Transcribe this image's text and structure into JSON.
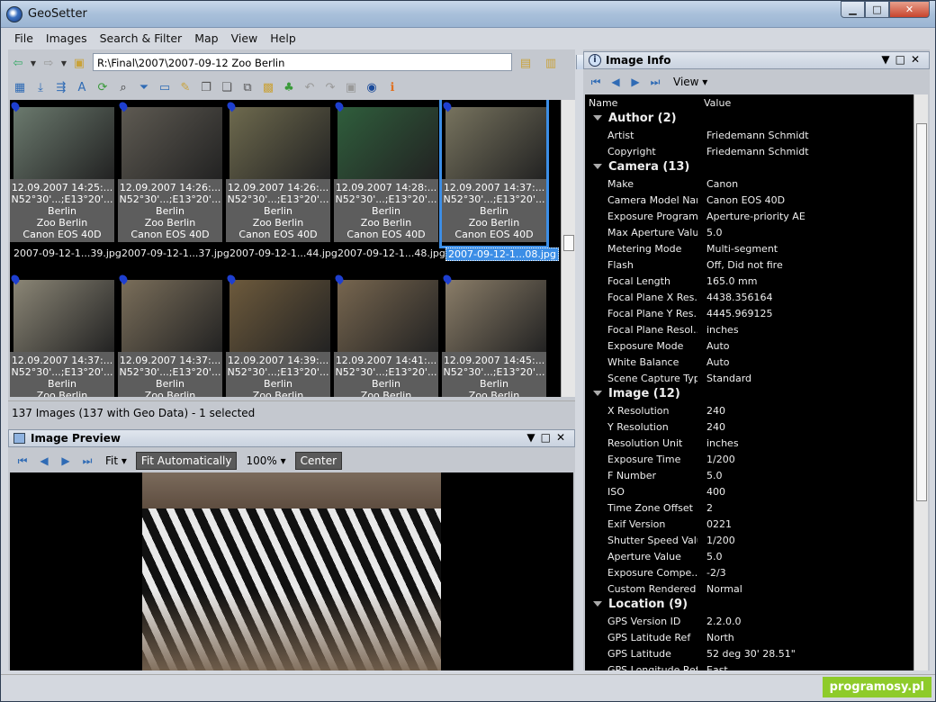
{
  "window": {
    "title": "GeoSetter"
  },
  "menu": [
    "File",
    "Images",
    "Search & Filter",
    "Map",
    "View",
    "Help"
  ],
  "address": {
    "path": "R:\\Final\\2007\\2007-09-12 Zoo Berlin"
  },
  "thumbnails": [
    {
      "meta": [
        "12.09.2007 14:25:...",
        "N52°30'...;E13°20'...",
        "Berlin",
        "Zoo Berlin",
        "Canon EOS 40D"
      ],
      "file": "2007-09-12-1...39.jpg",
      "color": "#6b7a6e"
    },
    {
      "meta": [
        "12.09.2007 14:26:...",
        "N52°30'...;E13°20'...",
        "Berlin",
        "Zoo Berlin",
        "Canon EOS 40D"
      ],
      "file": "2007-09-12-1...37.jpg",
      "color": "#5e5a52"
    },
    {
      "meta": [
        "12.09.2007 14:26:...",
        "N52°30'...;E13°20'...",
        "Berlin",
        "Zoo Berlin",
        "Canon EOS 40D"
      ],
      "file": "2007-09-12-1...44.jpg",
      "color": "#6e6a4e"
    },
    {
      "meta": [
        "12.09.2007 14:28:...",
        "N52°30'...;E13°20'...",
        "Berlin",
        "Zoo Berlin",
        "Canon EOS 40D"
      ],
      "file": "2007-09-12-1...48.jpg",
      "color": "#2f5e3c"
    },
    {
      "meta": [
        "12.09.2007 14:37:...",
        "N52°30'...;E13°20'...",
        "Berlin",
        "Zoo Berlin",
        "Canon EOS 40D"
      ],
      "file": "2007-09-12-1...08.jpg",
      "color": "#77735e"
    },
    {
      "meta": [
        "12.09.2007 14:37:...",
        "N52°30'...;E13°20'...",
        "Berlin",
        "Zoo Berlin"
      ],
      "file": "",
      "color": "#8b8676"
    },
    {
      "meta": [
        "12.09.2007 14:37:...",
        "N52°30'...;E13°20'...",
        "Berlin",
        "Zoo Berlin"
      ],
      "file": "",
      "color": "#7a6e5a"
    },
    {
      "meta": [
        "12.09.2007 14:39:...",
        "N52°30'...;E13°20'...",
        "Berlin",
        "Zoo Berlin"
      ],
      "file": "",
      "color": "#6d5a3c"
    },
    {
      "meta": [
        "12.09.2007 14:41:...",
        "N52°30'...;E13°20'...",
        "Berlin",
        "Zoo Berlin"
      ],
      "file": "",
      "color": "#77664f"
    },
    {
      "meta": [
        "12.09.2007 14:45:...",
        "N52°30'...;E13°20'...",
        "Berlin",
        "Zoo Berlin"
      ],
      "file": "",
      "color": "#8a7d68"
    }
  ],
  "status": "137 Images (137 with Geo Data) - 1 selected",
  "preview": {
    "title": "Image Preview",
    "fit": "Fit",
    "fit_auto": "Fit Automatically",
    "zoom": "100%",
    "center": "Center"
  },
  "info": {
    "title": "Image Info",
    "view": "View",
    "col_name": "Name",
    "col_value": "Value"
  },
  "props": [
    {
      "g": "Author (2)"
    },
    {
      "k": "Artist",
      "v": "Friedemann Schmidt"
    },
    {
      "k": "Copyright",
      "v": "Friedemann Schmidt"
    },
    {
      "g": "Camera (13)"
    },
    {
      "k": "Make",
      "v": "Canon"
    },
    {
      "k": "Camera Model Name",
      "v": "Canon EOS 40D"
    },
    {
      "k": "Exposure Program",
      "v": "Aperture-priority AE"
    },
    {
      "k": "Max Aperture Value",
      "v": "5.0"
    },
    {
      "k": "Metering Mode",
      "v": "Multi-segment"
    },
    {
      "k": "Flash",
      "v": "Off, Did not fire"
    },
    {
      "k": "Focal Length",
      "v": "165.0 mm"
    },
    {
      "k": "Focal Plane X Res...",
      "v": "4438.356164"
    },
    {
      "k": "Focal Plane Y Res...",
      "v": "4445.969125"
    },
    {
      "k": "Focal Plane Resol...",
      "v": "inches"
    },
    {
      "k": "Exposure Mode",
      "v": "Auto"
    },
    {
      "k": "White Balance",
      "v": "Auto"
    },
    {
      "k": "Scene Capture Type",
      "v": "Standard"
    },
    {
      "g": "Image (12)"
    },
    {
      "k": "X Resolution",
      "v": "240"
    },
    {
      "k": "Y Resolution",
      "v": "240"
    },
    {
      "k": "Resolution Unit",
      "v": "inches"
    },
    {
      "k": "Exposure Time",
      "v": "1/200"
    },
    {
      "k": "F Number",
      "v": "5.0"
    },
    {
      "k": "ISO",
      "v": "400"
    },
    {
      "k": "Time Zone Offset",
      "v": "2"
    },
    {
      "k": "Exif Version",
      "v": "0221"
    },
    {
      "k": "Shutter Speed Value",
      "v": "1/200"
    },
    {
      "k": "Aperture Value",
      "v": "5.0"
    },
    {
      "k": "Exposure Compe...",
      "v": "-2/3"
    },
    {
      "k": "Custom Rendered",
      "v": "Normal"
    },
    {
      "g": "Location (9)"
    },
    {
      "k": "GPS Version ID",
      "v": "2.2.0.0"
    },
    {
      "k": "GPS Latitude Ref",
      "v": "North"
    },
    {
      "k": "GPS Latitude",
      "v": "52 deg 30' 28.51\""
    },
    {
      "k": "GPS Longitude Ref",
      "v": "East"
    }
  ],
  "watermark": "programosy.pl"
}
